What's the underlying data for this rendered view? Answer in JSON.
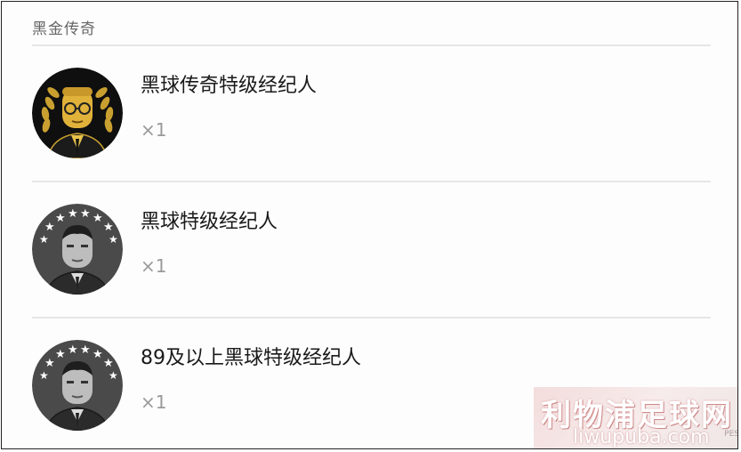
{
  "section": {
    "title": "黑金传奇"
  },
  "items": [
    {
      "title": "黑球传奇特级经纪人",
      "quantity": "×1",
      "avatar": "gold-laurel-agent-icon"
    },
    {
      "title": "黑球特级经纪人",
      "quantity": "×1",
      "avatar": "star-agent-icon"
    },
    {
      "title": "89及以上黑球特级经纪人",
      "quantity": "×1",
      "avatar": "star-agent-icon"
    }
  ],
  "watermark": {
    "main": "利物浦足球网",
    "sub": "liwupuba.com",
    "side": "PES"
  },
  "colors": {
    "gold": "#d4a72c",
    "dark": "#111111",
    "gray": "#555555",
    "divider": "#e6e6e6"
  }
}
